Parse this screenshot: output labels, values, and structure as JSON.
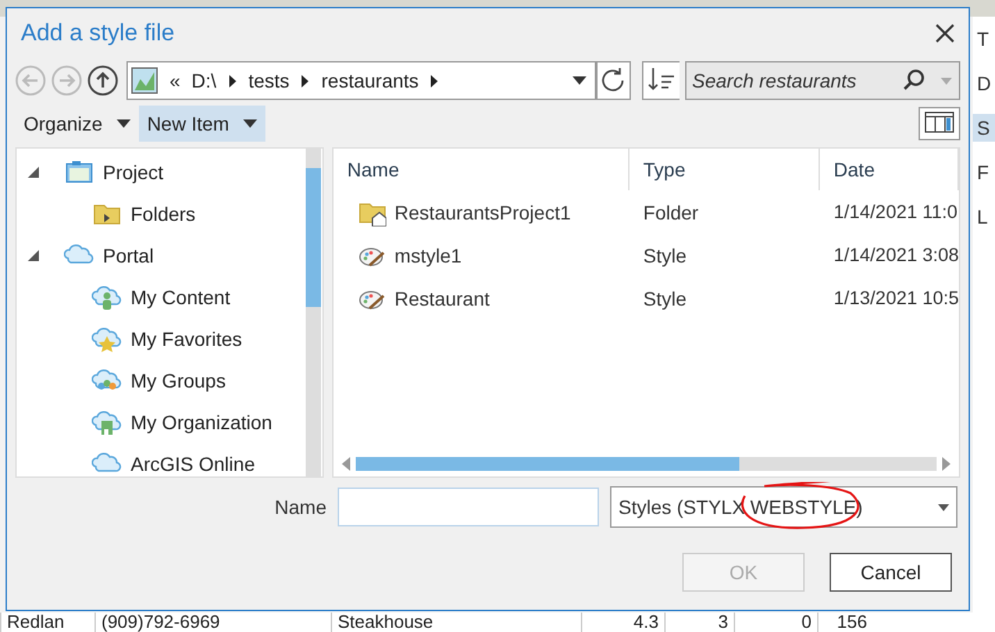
{
  "background": {
    "side_items": [
      {
        "text": "T",
        "selected": false
      },
      {
        "text": "D",
        "selected": false
      },
      {
        "text": "S",
        "selected": true
      },
      {
        "text": "F",
        "selected": false
      },
      {
        "text": "L",
        "selected": false
      }
    ],
    "table_row": [
      "Redlan",
      "(909)792-6969",
      "Steakhouse",
      "4.3",
      "3",
      "0",
      "156"
    ]
  },
  "dialog": {
    "title": "Add a style file",
    "nav": {
      "back_disabled": true,
      "forward_disabled": true,
      "up_disabled": false
    },
    "address": {
      "overflow": "«",
      "crumbs": [
        "D:\\",
        "tests",
        "restaurants"
      ]
    },
    "search": {
      "placeholder": "Search restaurants"
    },
    "toolbar": [
      {
        "label": "Organize",
        "selected": false
      },
      {
        "label": "New Item",
        "selected": true
      }
    ],
    "tree": [
      {
        "label": "Project",
        "kind": "project",
        "expanded": true,
        "children": [
          {
            "label": "Folders",
            "kind": "folder"
          }
        ]
      },
      {
        "label": "Portal",
        "kind": "portal",
        "expanded": true,
        "children": [
          {
            "label": "My Content",
            "kind": "content"
          },
          {
            "label": "My Favorites",
            "kind": "favorites"
          },
          {
            "label": "My Groups",
            "kind": "groups"
          },
          {
            "label": "My Organization",
            "kind": "organization"
          },
          {
            "label": "ArcGIS Online",
            "kind": "cloud"
          }
        ]
      }
    ],
    "columns": [
      "Name",
      "Type",
      "Date"
    ],
    "rows": [
      {
        "kind": "project-folder",
        "name": "RestaurantsProject1",
        "type": "Folder",
        "date": "1/14/2021 11:0"
      },
      {
        "kind": "style",
        "name": "mstyle1",
        "type": "Style",
        "date": "1/14/2021 3:08"
      },
      {
        "kind": "style",
        "name": "Restaurant",
        "type": "Style",
        "date": "1/13/2021 10:5"
      }
    ],
    "name_label": "Name",
    "file_type": "Styles (STYLX WEBSTYLE)",
    "buttons": [
      {
        "label": "OK",
        "disabled": true
      },
      {
        "label": "Cancel",
        "disabled": false
      }
    ]
  }
}
